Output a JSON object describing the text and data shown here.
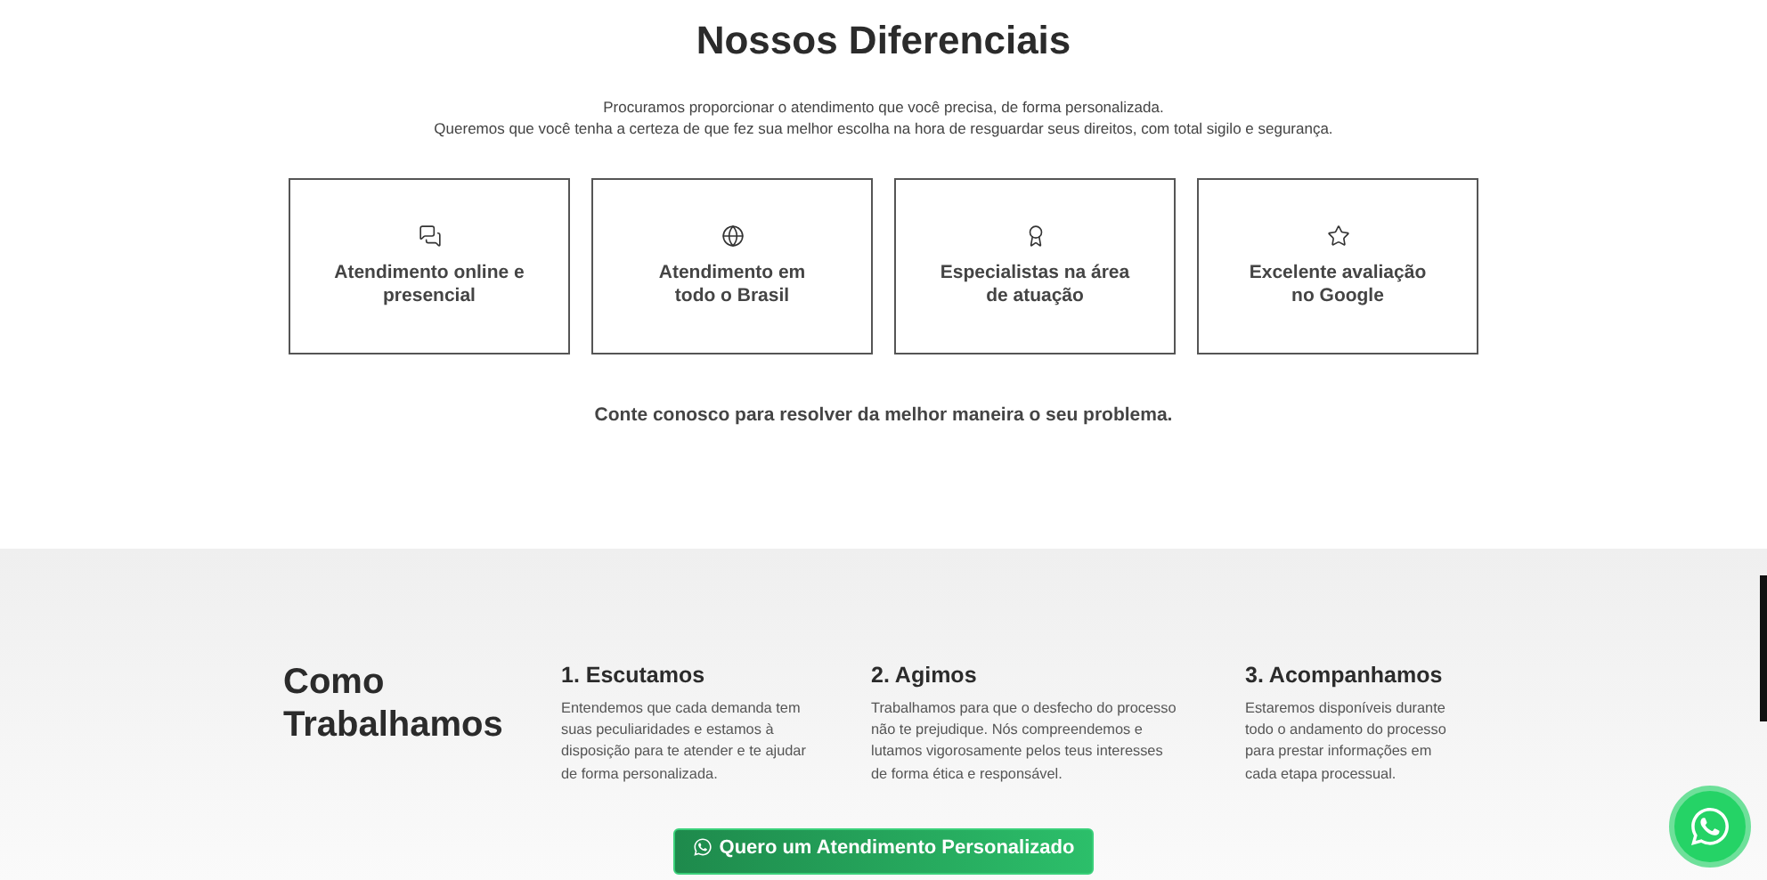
{
  "differentials": {
    "title": "Nossos Diferenciais",
    "intro": [
      "Procuramos proporcionar o atendimento que você precisa, de forma personalizada.",
      "Queremos que você tenha a certeza de que fez sua melhor escolha na hora de resguardar seus direitos, com total sigilo e segurança."
    ],
    "cards": [
      {
        "kind": "chat",
        "lines": [
          "Atendimento online e",
          "presencial"
        ]
      },
      {
        "kind": "globe",
        "lines": [
          "Atendimento em",
          "todo o Brasil"
        ]
      },
      {
        "kind": "award",
        "lines": [
          "Especialistas na área",
          "de atuação"
        ]
      },
      {
        "kind": "star",
        "lines": [
          "Excelente avaliação",
          "no Google"
        ]
      }
    ],
    "closing": "Conte conosco para resolver da melhor maneira o seu problema."
  },
  "how_we_work": {
    "title_lines": [
      "Como",
      "Trabalhamos"
    ],
    "steps": [
      {
        "title": "1. Escutamos",
        "text": [
          "Entendemos que cada demanda tem",
          "suas peculiaridades e estamos à",
          "disposição para te atender e te ajudar",
          "de forma personalizada."
        ]
      },
      {
        "title": "2. Agimos",
        "text": [
          "Trabalhamos para que o desfecho do processo",
          "não te prejudique. Nós compreendemos e",
          "lutamos vigorosamente pelos teus interesses",
          "de forma ética e responsável."
        ]
      },
      {
        "title": "3. Acompanhamos",
        "text": [
          "Estaremos disponíveis durante",
          "todo o andamento do processo",
          "para prestar informações em",
          "cada etapa processual."
        ]
      }
    ],
    "cta_button": "Quero um Atendimento Personalizado"
  }
}
